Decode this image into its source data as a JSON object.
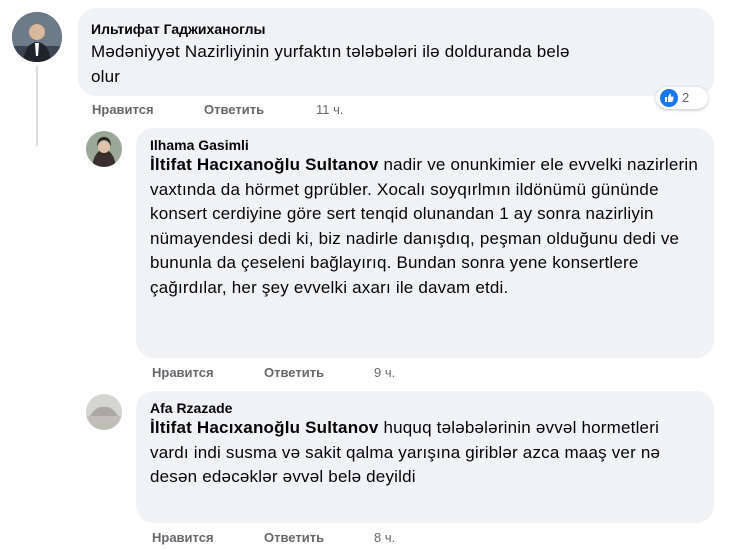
{
  "comments": [
    {
      "author": "Ильтифат Гаджиханоглы",
      "text": "Mədəniyyət Nazirliyinin yurfaktın tələbələri ilə dolduranda belə olur",
      "actions": {
        "like": "Нравится",
        "reply": "Ответить",
        "time": "11 ч."
      },
      "reactions": {
        "count": "2",
        "icon": "like-icon"
      }
    },
    {
      "author": "Ilhama Gasimli",
      "tag": "İltifat Hacıxanoğlu Sultanov",
      "text": "nadir ve onunkimier ele evvelki nazirlerin vaxtında da hörmet gprübler. Xocalı soyqırlmın ildönümü gününde konsert cerdiyine göre sert tenqid olunandan 1 ay sonra nazirliyin nümayendesi dedi ki, biz nadirle danışdıq, peşman olduğunu dedi ve bununla da çeseleni bağlayırıq. Bundan sonra yene konsertlere çağırdılar, her şey evvelki axarı ile davam etdi.",
      "actions": {
        "like": "Нравится",
        "reply": "Ответить",
        "time": "9 ч."
      }
    },
    {
      "author": "Afa Rzazade",
      "tag": "İltifat Hacıxanoğlu Sultanov",
      "text": "huquq tələbələrinin əvvəl hormetleri vardı indi susma və sakit qalma yarışına giriblər azca maaş ver nə desən edəcəklər əvvəl belə deyildi",
      "actions": {
        "like": "Нравится",
        "reply": "Ответить",
        "time": "8 ч."
      }
    }
  ]
}
